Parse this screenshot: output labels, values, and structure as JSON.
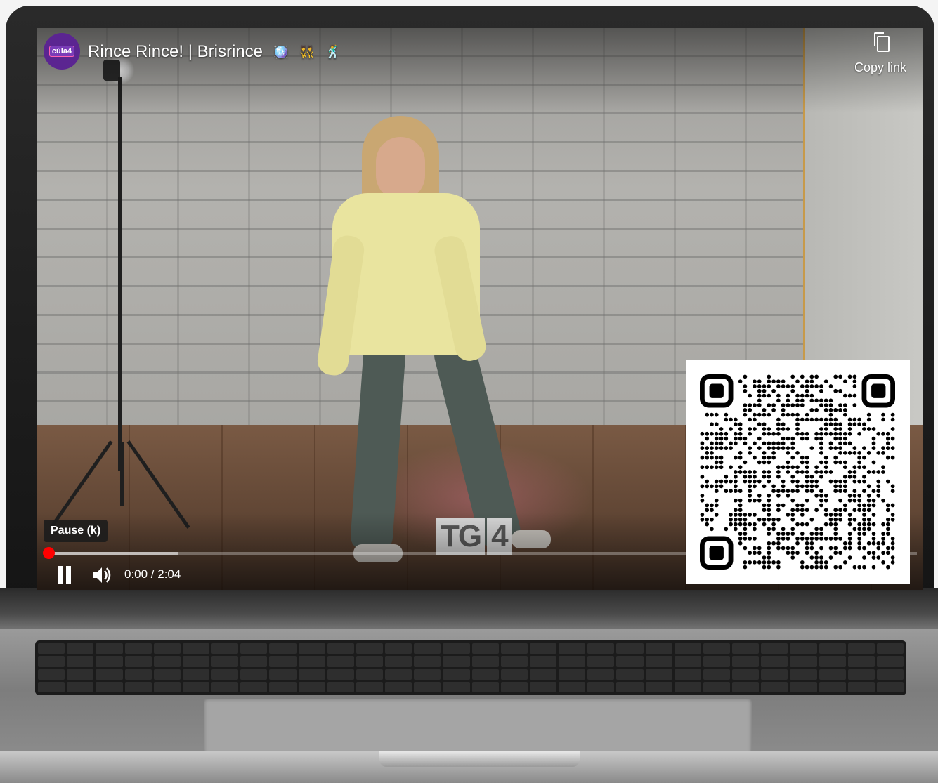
{
  "video": {
    "title": "Rince Rince! | Brisrince",
    "title_emojis": [
      "🪩",
      "👯",
      "🕺"
    ],
    "channel_logo_text": "cúla4",
    "watermark": [
      "TG",
      "4"
    ]
  },
  "overlay": {
    "copy_link_label": "Copy link",
    "copy_icon": "copy-icon"
  },
  "controls": {
    "tooltip": "Pause (k)",
    "time_display": "0:00 / 2:04",
    "played_fraction": 0.0,
    "buffered_fraction": 0.15,
    "pause_icon": "pause-icon",
    "volume_icon": "volume-icon"
  },
  "colors": {
    "progress_red": "#ff0000",
    "channel_purple": "#5b2591"
  }
}
